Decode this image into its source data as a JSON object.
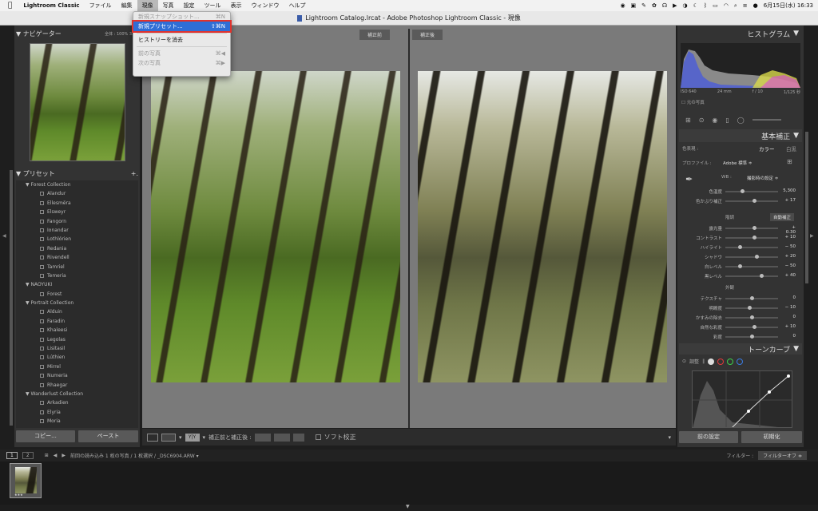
{
  "menubar": {
    "app": "Lightroom Classic",
    "items": [
      "ファイル",
      "編集",
      "現像",
      "写真",
      "設定",
      "ツール",
      "表示",
      "ウィンドウ",
      "ヘルプ"
    ],
    "active": "現像",
    "datetime": "6月15日(水)  16:33"
  },
  "window_title": "Lightroom Catalog.lrcat - Adobe Photoshop Lightroom Classic - 現像",
  "dropdown": {
    "items": [
      {
        "label": "新規スナップショット...",
        "shortcut": "⌘N",
        "state": "disabled"
      },
      {
        "label": "新規プリセット...",
        "shortcut": "⇧⌘N",
        "state": "highlighted"
      },
      {
        "label": "ヒストリーを消去",
        "shortcut": "",
        "state": "normal"
      },
      {
        "label": "前の写真",
        "shortcut": "⌘◀",
        "state": "disabled"
      },
      {
        "label": "次の写真",
        "shortcut": "⌘▶",
        "state": "disabled"
      }
    ]
  },
  "navigator": {
    "title": "ナビゲーター",
    "zoom_options": [
      "全体 :",
      "100%",
      "33%"
    ]
  },
  "presets": {
    "title": "プリセット",
    "add": "+.",
    "rows": [
      {
        "type": "folder",
        "label": "Forest Collection"
      },
      {
        "type": "item",
        "label": "Alandur"
      },
      {
        "type": "item",
        "label": "Ellesmëra"
      },
      {
        "type": "item",
        "label": "Elsweyr"
      },
      {
        "type": "item",
        "label": "Fangorn"
      },
      {
        "type": "item",
        "label": "Ionandar"
      },
      {
        "type": "item",
        "label": "Lothlórien"
      },
      {
        "type": "item",
        "label": "Redania"
      },
      {
        "type": "item",
        "label": "Rivendell"
      },
      {
        "type": "item",
        "label": "Tamriel"
      },
      {
        "type": "item",
        "label": "Temeria"
      },
      {
        "type": "folder",
        "label": "NAOYUKI"
      },
      {
        "type": "item",
        "label": "Forest"
      },
      {
        "type": "folder",
        "label": "Portrait Collection"
      },
      {
        "type": "item",
        "label": "Alduin"
      },
      {
        "type": "item",
        "label": "Faradin"
      },
      {
        "type": "item",
        "label": "Khaleesi"
      },
      {
        "type": "item",
        "label": "Legolas"
      },
      {
        "type": "item",
        "label": "Lisitasil"
      },
      {
        "type": "item",
        "label": "Lúthien"
      },
      {
        "type": "item",
        "label": "Mirrel"
      },
      {
        "type": "item",
        "label": "Numeria"
      },
      {
        "type": "item",
        "label": "Rhaegar"
      },
      {
        "type": "folder",
        "label": "Wanderlust Collection"
      },
      {
        "type": "item",
        "label": "Arkadien"
      },
      {
        "type": "item",
        "label": "Elyria"
      },
      {
        "type": "item",
        "label": "Moria"
      }
    ]
  },
  "left_buttons": {
    "copy": "コピー...",
    "paste": "ペースト"
  },
  "compare": {
    "before": "補正前",
    "after": "補正後"
  },
  "toolbar": {
    "compare_label": "補正前と補正後 :",
    "soft_proof": "ソフト校正"
  },
  "histogram": {
    "title": "ヒストグラム",
    "meta": [
      "ISO 640",
      "24 mm",
      "f / 10",
      "1/125 秒"
    ],
    "original": "元の写真"
  },
  "basic": {
    "title": "基本補正",
    "treatment_label": "色表現 :",
    "treatment_color": "カラー",
    "treatment_bw": "白黒",
    "profile_label": "プロファイル :",
    "profile_value": "Adobe 標準 ≑",
    "wb_label": "WB :",
    "wb_value": "撮影時の設定 ≑",
    "sliders1": [
      {
        "label": "色温度",
        "value": "5,300",
        "pos": 0.3
      },
      {
        "label": "色かぶり補正",
        "value": "+ 17",
        "pos": 0.55
      }
    ],
    "tone_label": "階調",
    "auto": "自動補正",
    "sliders2": [
      {
        "label": "露光量",
        "value": "+ 0.30",
        "pos": 0.55
      },
      {
        "label": "コントラスト",
        "value": "+ 10",
        "pos": 0.55
      },
      {
        "label": "ハイライト",
        "value": "− 50",
        "pos": 0.25
      },
      {
        "label": "シャドウ",
        "value": "+ 20",
        "pos": 0.6
      },
      {
        "label": "白レベル",
        "value": "− 50",
        "pos": 0.25
      },
      {
        "label": "黒レベル",
        "value": "+ 40",
        "pos": 0.7
      }
    ],
    "presence_label": "外観",
    "sliders3": [
      {
        "label": "テクスチャ",
        "value": "0",
        "pos": 0.5
      },
      {
        "label": "明瞭度",
        "value": "− 10",
        "pos": 0.45
      },
      {
        "label": "かすみの除去",
        "value": "0",
        "pos": 0.5
      },
      {
        "label": "自然な彩度",
        "value": "+ 10",
        "pos": 0.55
      },
      {
        "label": "彩度",
        "value": "0",
        "pos": 0.5
      }
    ]
  },
  "tone_curve": {
    "title": "トーンカーブ",
    "adjust": "調整"
  },
  "right_buttons": {
    "previous": "前の設定",
    "reset": "初期化"
  },
  "filmstrip": {
    "pages": [
      "1",
      "2"
    ],
    "source": "前回の読み込み  1 枚の写真 / 1 枚選択 / _DSC6904.ARW ▾",
    "filter_label": "フィルター :",
    "filter_value": "フィルターオフ ≑",
    "rating": "★★★"
  }
}
